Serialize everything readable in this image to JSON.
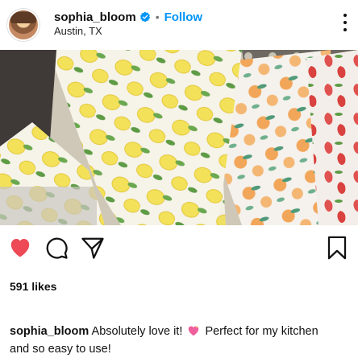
{
  "header": {
    "username": "sophia_bloom",
    "follow_label": "Follow",
    "separator": "•",
    "location": "Austin, TX"
  },
  "colors": {
    "follow_blue": "#0095f6",
    "like_red": "#ed4956",
    "verified_blue": "#0095f6"
  },
  "actions": {
    "like_icon": "heart-filled-icon",
    "comment_icon": "comment-icon",
    "share_icon": "send-icon",
    "save_icon": "bookmark-icon"
  },
  "likes": {
    "text": "591 likes"
  },
  "caption": {
    "username": "sophia_bloom",
    "text_before_emoji": "Absolutely love it!",
    "text_after_emoji": "Perfect for my kitchen",
    "text_line2": "and so easy to use!"
  }
}
